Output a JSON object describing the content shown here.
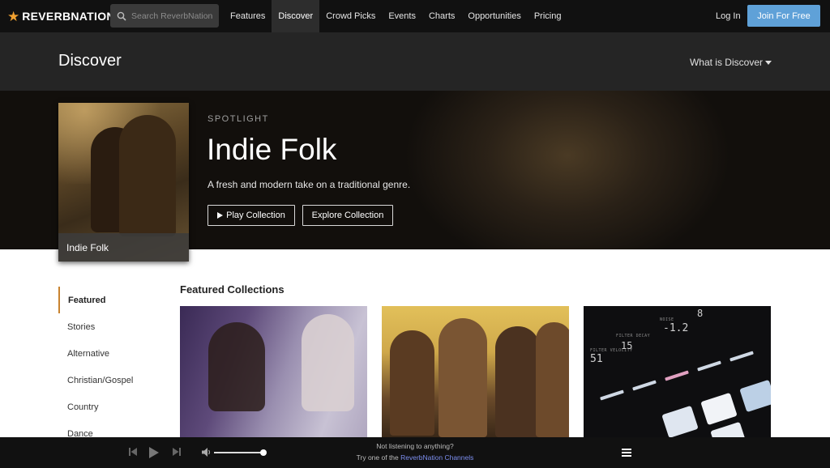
{
  "nav": {
    "logo_text": "REVERBNATION",
    "logo_mark": "®",
    "search_placeholder": "Search ReverbNation",
    "items": [
      {
        "label": "Features"
      },
      {
        "label": "Discover"
      },
      {
        "label": "Crowd Picks"
      },
      {
        "label": "Events"
      },
      {
        "label": "Charts"
      },
      {
        "label": "Opportunities"
      },
      {
        "label": "Pricing"
      }
    ],
    "active_item": "Discover",
    "login": "Log In",
    "join": "Join For Free"
  },
  "discover": {
    "title": "Discover",
    "what_is": "What is Discover"
  },
  "spotlight": {
    "eyebrow": "SPOTLIGHT",
    "title": "Indie Folk",
    "description": "A fresh and modern take on a traditional genre.",
    "card_label": "Indie Folk",
    "play_button": "Play Collection",
    "explore_button": "Explore Collection"
  },
  "sidebar": {
    "items": [
      {
        "label": "Featured"
      },
      {
        "label": "Stories"
      },
      {
        "label": "Alternative"
      },
      {
        "label": "Christian/Gospel"
      },
      {
        "label": "Country"
      },
      {
        "label": "Dance"
      }
    ],
    "active_item": "Featured"
  },
  "featured": {
    "title": "Featured Collections",
    "tile3": {
      "labels": [
        "FILTER VELOCITY",
        "FILTER DECAY",
        "NOISE"
      ],
      "readouts": [
        "51",
        "15",
        "-1.2",
        "8"
      ]
    }
  },
  "player": {
    "not_listening": "Not listening to anything?",
    "try_prefix": "Try one of the ",
    "try_link": "ReverbNation Channels",
    "volume_level": 0.95
  },
  "colors": {
    "accent_blue": "#5fa1d8",
    "accent_orange": "#c8832f",
    "link_purple": "#7d8ff0",
    "nav_bg": "#111111"
  }
}
